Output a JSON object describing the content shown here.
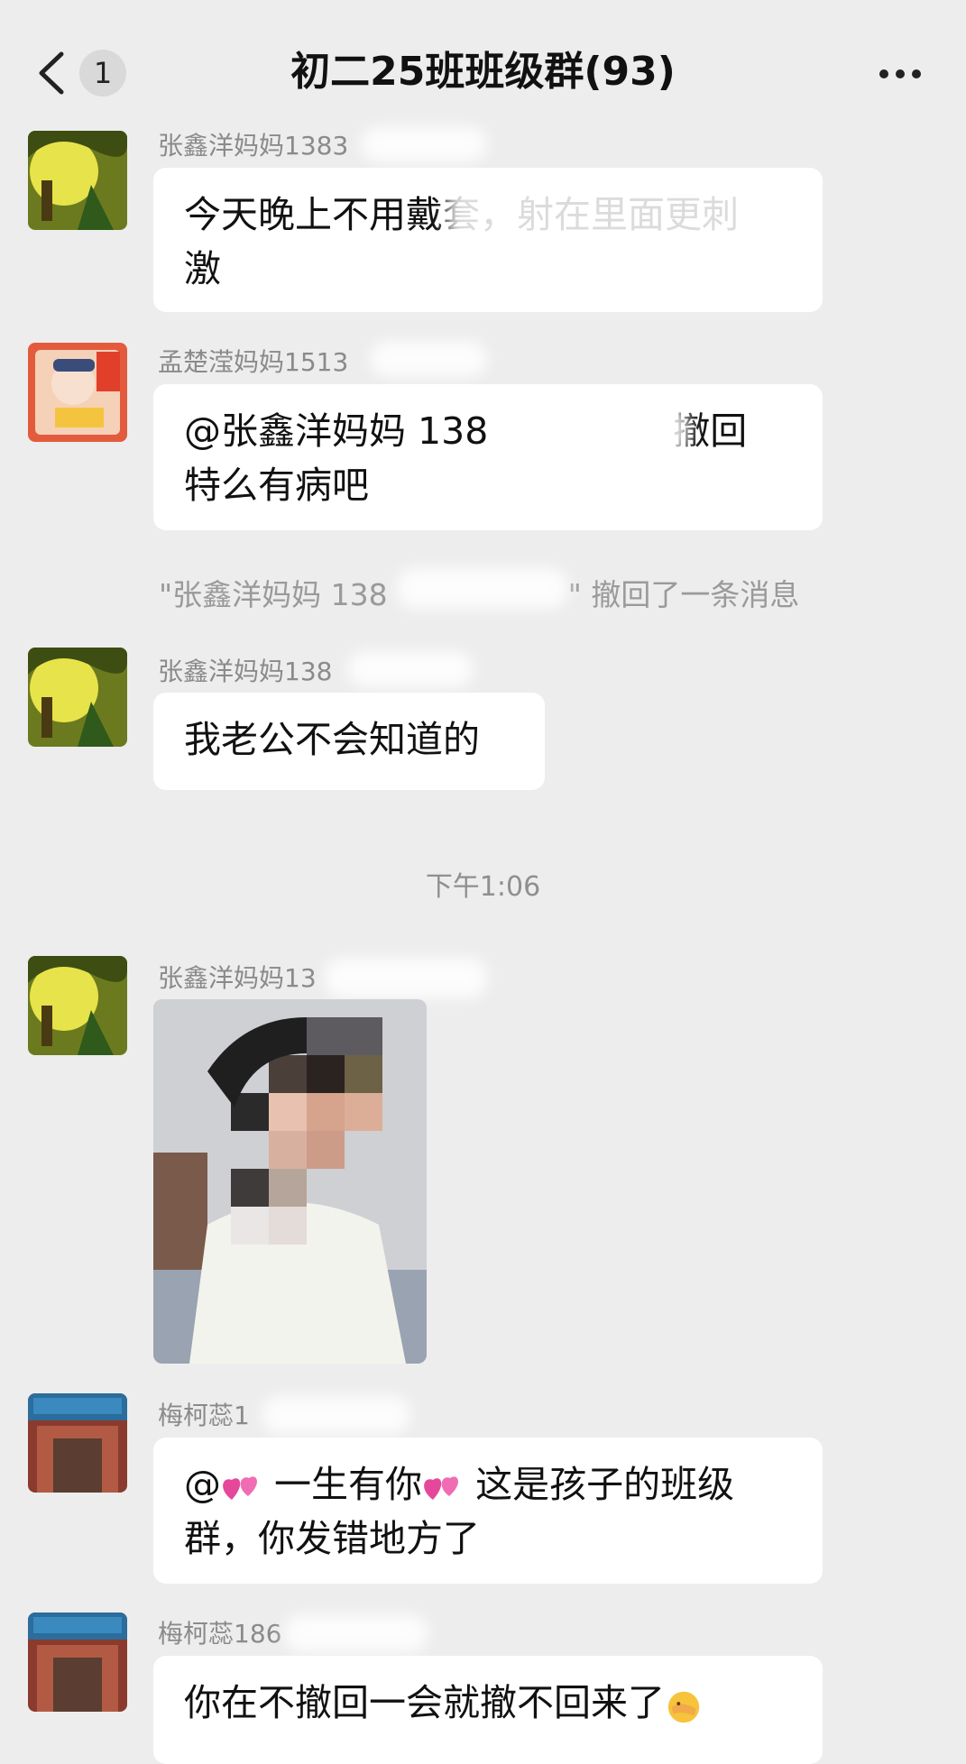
{
  "header": {
    "back_badge": "1",
    "title": "初二25班班级群(93)"
  },
  "messages": [
    {
      "sender": "张鑫洋妈妈1383",
      "text_line1": "今天晚上不用戴套，射在里面更刺",
      "text_line2": "激"
    },
    {
      "sender": "孟楚滢妈妈1513",
      "text_line1": "@张鑫洋妈妈 138",
      "text_line1_tail": "撤回",
      "text_line2": "特么有病吧"
    },
    {
      "sender": "张鑫洋妈妈138",
      "text": "我老公不会知道的"
    },
    {
      "sender": "张鑫洋妈妈13"
    },
    {
      "sender": "梅柯蕊1",
      "mention_prefix": "@",
      "mention_name": "一生有你",
      "text_line1_tail": "这是孩子的班级",
      "text_line2": "群，你发错地方了"
    },
    {
      "sender": "梅柯蕊186",
      "text": "你在不撤回一会就撤不回来了"
    }
  ],
  "system": {
    "recall_prefix": "\"张鑫洋妈妈 138",
    "recall_suffix": "\" 撤回了一条消息"
  },
  "timestamp": "下午1:06",
  "colors": {
    "background": "#ededed",
    "bubble": "#ffffff",
    "meta_text": "#8a8a8a"
  }
}
